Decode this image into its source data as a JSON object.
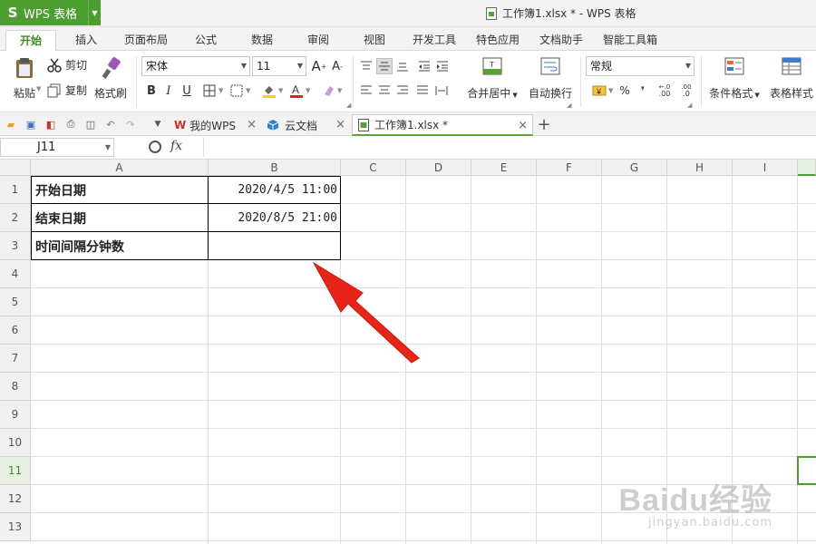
{
  "app": {
    "logo": "S",
    "name": "WPS 表格",
    "window_title": "工作簿1.xlsx * - WPS 表格"
  },
  "ribbon_tabs": [
    {
      "label": "开始",
      "active": true
    },
    {
      "label": "插入"
    },
    {
      "label": "页面布局"
    },
    {
      "label": "公式"
    },
    {
      "label": "数据"
    },
    {
      "label": "审阅"
    },
    {
      "label": "视图"
    },
    {
      "label": "开发工具"
    },
    {
      "label": "特色应用"
    },
    {
      "label": "文档助手"
    },
    {
      "label": "智能工具箱"
    }
  ],
  "toolbar": {
    "paste": "粘贴",
    "cut": "剪切",
    "copy": "复制",
    "format_painter": "格式刷",
    "font_name": "宋体",
    "font_size": "11",
    "bold": "B",
    "italic": "I",
    "underline": "U",
    "merge_center": "合并居中",
    "wrap_text": "自动换行",
    "number_format": "常规",
    "percent": "%",
    "comma": "❜",
    "inc_decimal": ".00",
    "dec_decimal": ".0",
    "conditional_format": "条件格式",
    "table_style": "表格样式"
  },
  "doc_tabs": [
    {
      "label": "我的WPS",
      "icon": "wps-logo-icon"
    },
    {
      "label": "云文档",
      "icon": "cloud-doc-icon"
    },
    {
      "label": "工作簿1.xlsx *",
      "icon": "sheet-doc-icon",
      "active": true
    }
  ],
  "formula_bar": {
    "cell_ref": "J11",
    "fx": "fx",
    "value": ""
  },
  "sheet": {
    "columns": [
      "A",
      "B",
      "C",
      "D",
      "E",
      "F",
      "G",
      "H",
      "I"
    ],
    "rows": [
      "1",
      "2",
      "3",
      "4",
      "5",
      "6",
      "7",
      "8",
      "9",
      "10",
      "11",
      "12",
      "13"
    ],
    "selected_row": "11",
    "cells": {
      "A1": "开始日期",
      "B1": "2020/4/5 11:00",
      "A2": "结束日期",
      "B2": "2020/8/5 21:00",
      "A3": "时间间隔分钟数",
      "B3": ""
    }
  },
  "watermark": {
    "main": "Baidu经验",
    "sub": "jingyan.baidu.com"
  },
  "colors": {
    "accent_green": "#4b9e2f",
    "arrow_red": "#e8231a"
  }
}
